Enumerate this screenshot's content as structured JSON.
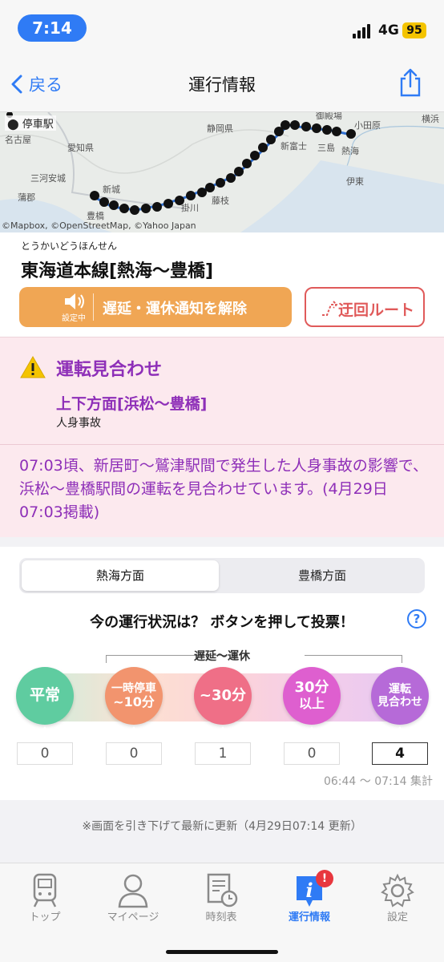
{
  "status_bar": {
    "time": "7:14",
    "network": "4G",
    "battery": "95"
  },
  "nav": {
    "back_label": "戻る",
    "title": "運行情報"
  },
  "map": {
    "legend": "停車駅",
    "credit": "©Mapbox, ©OpenStreetMap, ©Yahoo Japan",
    "place_labels": [
      "名古屋",
      "愛知県",
      "三河安城",
      "蒲郡",
      "新城",
      "豊橋",
      "掛川",
      "静岡県",
      "藤枝",
      "新富士",
      "三島",
      "熱海",
      "御殿場",
      "小田原",
      "伊東",
      "横浜"
    ]
  },
  "line": {
    "ruby": "とうかいどうほんせん",
    "name": "東海道本線[熱海〜豊橋]",
    "notify_status": "設定中",
    "notify_label": "遅延・運休通知を解除",
    "detour_label": "迂回ルート"
  },
  "alert": {
    "title": "運転見合わせ",
    "direction": "上下方面[浜松〜豊橋]",
    "cause": "人身事故",
    "message": "07:03頃、新居町〜鷲津駅間で発生した人身事故の影響で、浜松〜豊橋駅間の運転を見合わせています。(4月29日07:03掲載)"
  },
  "vote": {
    "tabs": [
      {
        "label": "熱海方面",
        "selected": true
      },
      {
        "label": "豊橋方面",
        "selected": false
      }
    ],
    "question": "今の運行状況は？ ボタンを押して投票！",
    "help": "?",
    "range_label": "遅延〜運休",
    "options": [
      {
        "line1": "平常",
        "line2": "",
        "count": "0",
        "color": "#5fcca0"
      },
      {
        "line1": "一時停車",
        "line2": "~10分",
        "count": "0",
        "color": "#f2946e"
      },
      {
        "line1": "~30分",
        "line2": "",
        "count": "1",
        "color": "#ef6f87"
      },
      {
        "line1": "30分",
        "line2": "以上",
        "count": "0",
        "color": "#de5fcf"
      },
      {
        "line1": "運転",
        "line2": "見合わせ",
        "count": "4",
        "color": "#b66ad8"
      }
    ],
    "aggregate": "06:44 〜 07:14 集計"
  },
  "refresh_note": "※画面を引き下げて最新に更新（4月29日07:14 更新）",
  "tabbar": {
    "items": [
      {
        "label": "トップ",
        "icon": "train-icon"
      },
      {
        "label": "マイページ",
        "icon": "person-icon"
      },
      {
        "label": "時刻表",
        "icon": "timetable-icon"
      },
      {
        "label": "運行情報",
        "icon": "info-icon",
        "badge": "!"
      },
      {
        "label": "設定",
        "icon": "gear-icon"
      }
    ]
  }
}
